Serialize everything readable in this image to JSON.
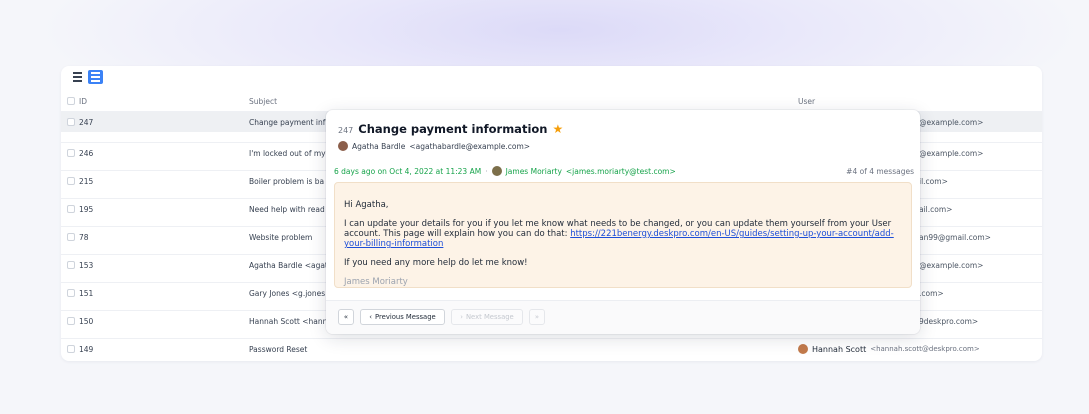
{
  "toolbar": {
    "list_icon": "list-view-icon",
    "detail_icon": "detail-view-icon"
  },
  "table": {
    "headers": {
      "id": "ID",
      "subject": "Subject",
      "user": "User"
    },
    "rows": [
      {
        "id": "247",
        "subject": "Change payment inf",
        "user_tail": "@example.com>"
      },
      {
        "id": "246",
        "subject": "I'm locked out of my",
        "user_tail": "@example.com>"
      },
      {
        "id": "215",
        "subject": "Boiler problem is ba",
        "user_tail": "il.com>"
      },
      {
        "id": "195",
        "subject": "Need help with read",
        "user_tail": "ail.com>"
      },
      {
        "id": "78",
        "subject": "Website problem",
        "user_tail": "an99@gmail.com>"
      },
      {
        "id": "153",
        "subject": "Agatha Bardle <agat",
        "user_tail": "@example.com>"
      },
      {
        "id": "151",
        "subject": "Gary Jones <g.jones",
        "user_tail": ".com>"
      },
      {
        "id": "150",
        "subject": "Hannah Scott <hann",
        "user_tail": "9deskpro.com>"
      },
      {
        "id": "149",
        "subject": "Password Reset",
        "user_name": "Hannah Scott",
        "user_email": "<hannah.scott@deskpro.com>"
      }
    ]
  },
  "popup": {
    "ticket_id": "247",
    "subject": "Change payment information",
    "star": "★",
    "from_name": "Agatha Bardle",
    "from_email": "<agathabardle@example.com>",
    "meta_time": "6 days ago on Oct 4, 2022 at 11:23 AM",
    "meta_sep": "·",
    "agent_name": "James Moriarty",
    "agent_email": "<james.moriarty@test.com>",
    "message_count": "#4 of 4 messages",
    "message": {
      "greeting": "Hi Agatha,",
      "body_text": "I can update your details for you if you let me know what needs to be changed, or you can update them yourself from your User account. This page will explain how you can do that: ",
      "link": "https://221benergy.deskpro.com/en-US/guides/setting-up-your-account/add-your-billing-information",
      "closing": "If you need any more help do let me know!",
      "signature": "James Moriarty"
    },
    "pager": {
      "first": "«",
      "prev": "Previous Message",
      "next": "Next Message",
      "last": "»"
    }
  },
  "colors": {
    "accent": "#3b82f6",
    "star": "#f59e0b",
    "meta_green": "#16a34a",
    "message_bg": "#fdf3e7"
  }
}
